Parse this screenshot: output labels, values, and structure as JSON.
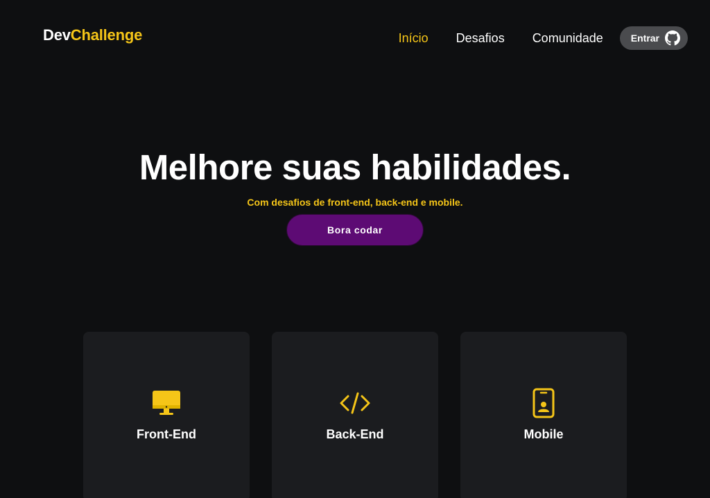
{
  "header": {
    "logo_part1": "Dev",
    "logo_part2": "Challenge",
    "nav": [
      {
        "label": "Início",
        "active": true
      },
      {
        "label": "Desafios",
        "active": false
      },
      {
        "label": "Comunidade",
        "active": false
      }
    ],
    "login_label": "Entrar",
    "login_icon": "github-icon"
  },
  "hero": {
    "title": "Melhore suas habilidades.",
    "subtitle": "Com desafios de front-end, back-end e mobile.",
    "cta_label": "Bora codar"
  },
  "cards": [
    {
      "label": "Front-End",
      "icon": "monitor-icon"
    },
    {
      "label": "Back-End",
      "icon": "code-icon"
    },
    {
      "label": "Mobile",
      "icon": "smartphone-icon"
    }
  ],
  "colors": {
    "background": "#0e0f11",
    "accent": "#f5c518",
    "cta": "#5d0b74",
    "card": "#1b1c1f",
    "login_pill": "#4a4b4e"
  }
}
